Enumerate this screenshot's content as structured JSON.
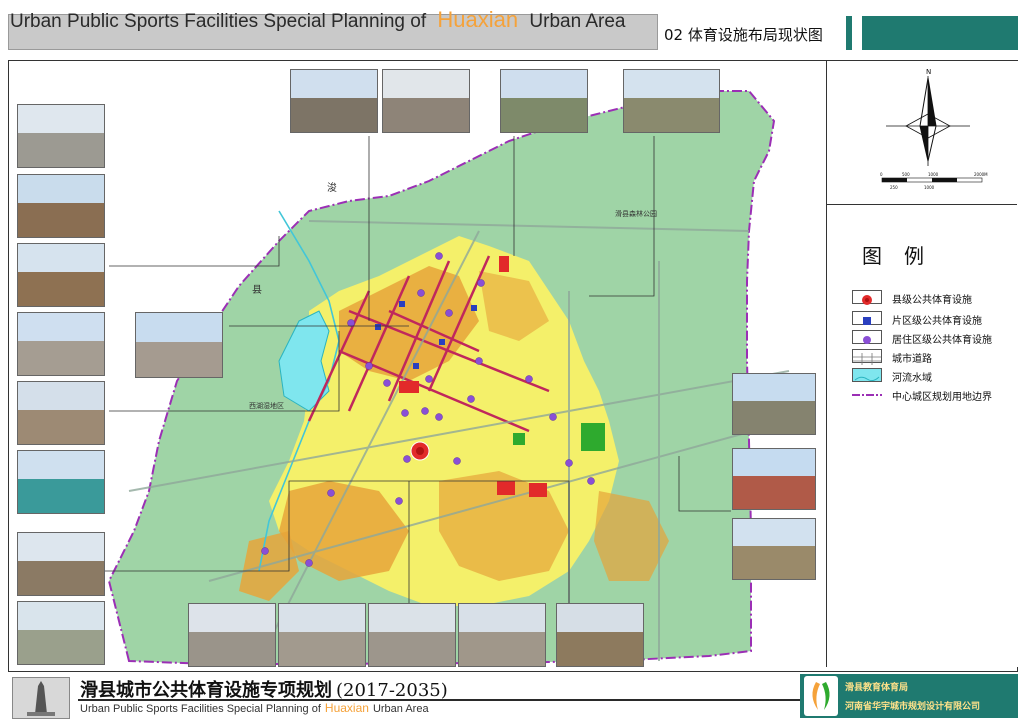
{
  "header": {
    "title_pre": "Urban Public Sports Facilities  Special Planning of",
    "title_highlight": "Huaxian",
    "title_post": "Urban Area",
    "subtitle": "02 体育设施布局现状图",
    "highlight_color": "#f5a23a",
    "bar_color": "#1f7a70"
  },
  "map": {
    "labels": {
      "river_name_1": "浚",
      "river_name_2": "县",
      "park": "滑县森林公园",
      "wetland": "西湖湿地区"
    },
    "colors": {
      "green_land": "#9fd4a6",
      "yellow_residential": "#f4f06a",
      "orange_residential": "#e6a43a",
      "red_facility": "#e22a2a",
      "water": "#7fe6ee",
      "boundary": "#9b2fb5",
      "road": "#c0275c",
      "district_facility": "#2a3fbf",
      "residential_facility": "#8a4fd6"
    }
  },
  "compass": {
    "north_label": "N",
    "scale_ticks": [
      "0",
      "500",
      "1000",
      "2000M"
    ],
    "scale_ticks_lower": [
      "250",
      "1000"
    ]
  },
  "legend": {
    "title": "图例",
    "items": [
      {
        "label": "县级公共体育设施",
        "symbol": "county-facility-icon"
      },
      {
        "label": "片区级公共体育设施",
        "symbol": "district-facility-icon"
      },
      {
        "label": "居住区级公共体育设施",
        "symbol": "residential-facility-icon"
      },
      {
        "label": "城市道路",
        "symbol": "road-icon"
      },
      {
        "label": "河流水域",
        "symbol": "water-icon"
      },
      {
        "label": "中心城区规划用地边界",
        "symbol": "boundary-icon"
      }
    ]
  },
  "footer": {
    "title_cn": "滑县城市公共体育设施专项规划",
    "years": "(2017-2035)",
    "title_en_pre": "Urban Public Sports Facilities  Special Planning of",
    "title_en_highlight": "Huaxian",
    "title_en_post": "Urban Area",
    "org1": "滑县教育体育局",
    "org2": "河南省华宇城市规划设计有限公司"
  }
}
